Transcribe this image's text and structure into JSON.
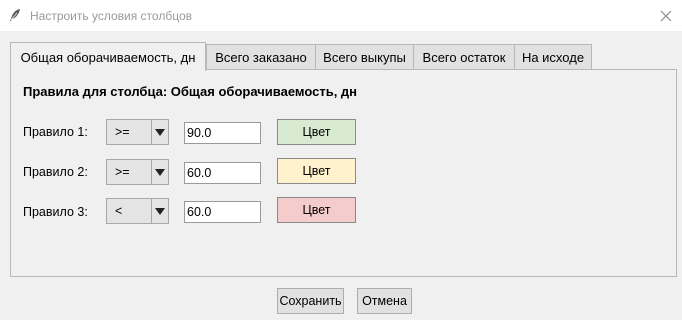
{
  "window": {
    "title": "Настроить условия столбцов",
    "close_symbol": "close-icon"
  },
  "tabs": [
    {
      "label": "Общая оборачиваемость, дн",
      "active": true
    },
    {
      "label": "Всего заказано",
      "active": false
    },
    {
      "label": "Всего выкупы",
      "active": false
    },
    {
      "label": "Всего остаток",
      "active": false
    },
    {
      "label": "На исходе",
      "active": false
    }
  ],
  "panel": {
    "title": "Правила для столбца: Общая оборачиваемость, дн",
    "rules": [
      {
        "label": "Правило 1:",
        "operator": ">=",
        "value": "90.0",
        "color_label": "Цвет",
        "color": "#d9ead3"
      },
      {
        "label": "Правило 2:",
        "operator": ">=",
        "value": "60.0",
        "color_label": "Цвет",
        "color": "#fff2cc"
      },
      {
        "label": "Правило 3:",
        "operator": "<",
        "value": "60.0",
        "color_label": "Цвет",
        "color": "#f4cccc"
      }
    ]
  },
  "buttons": {
    "save": "Сохранить",
    "cancel": "Отмена"
  }
}
